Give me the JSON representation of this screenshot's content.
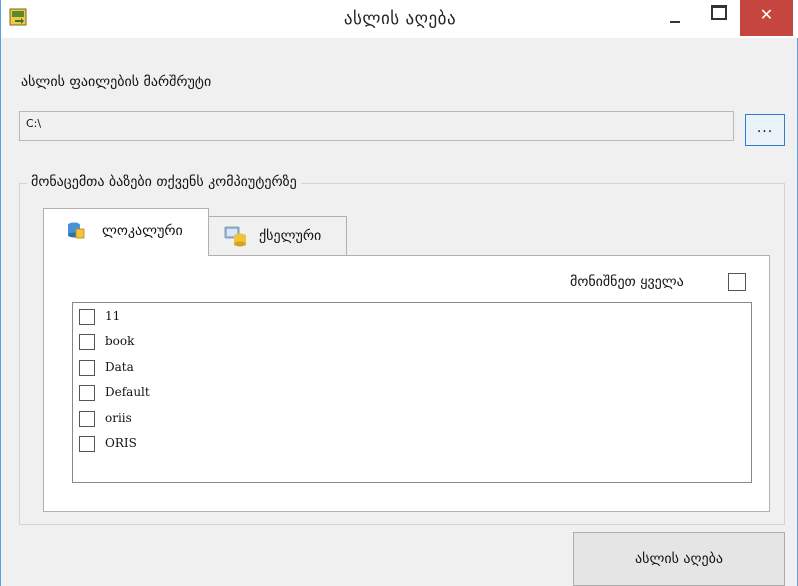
{
  "window": {
    "title": "ასლის აღება",
    "close_label": "✕",
    "accent_color": "#5aa0de",
    "close_color": "#c7453f"
  },
  "path": {
    "label": "ასლის ფაილების მარშრუტი",
    "value": "C:\\",
    "browse_label": "..."
  },
  "databases": {
    "legend": "მონაცემთა ბაზები თქვენს კომპიუტერზე",
    "tabs": [
      {
        "label": "ლოკალური",
        "icon": "database-icon",
        "active": true
      },
      {
        "label": "ქსელური",
        "icon": "network-database-icon",
        "active": false
      }
    ],
    "select_all_label": "მონიშნეთ ყველა",
    "items": [
      {
        "label": "11",
        "checked": false
      },
      {
        "label": "book",
        "checked": false
      },
      {
        "label": "Data",
        "checked": false
      },
      {
        "label": "Default",
        "checked": false
      },
      {
        "label": "oriis",
        "checked": false
      },
      {
        "label": "ORIS",
        "checked": false
      }
    ]
  },
  "actions": {
    "backup_label": "ასლის აღება"
  }
}
